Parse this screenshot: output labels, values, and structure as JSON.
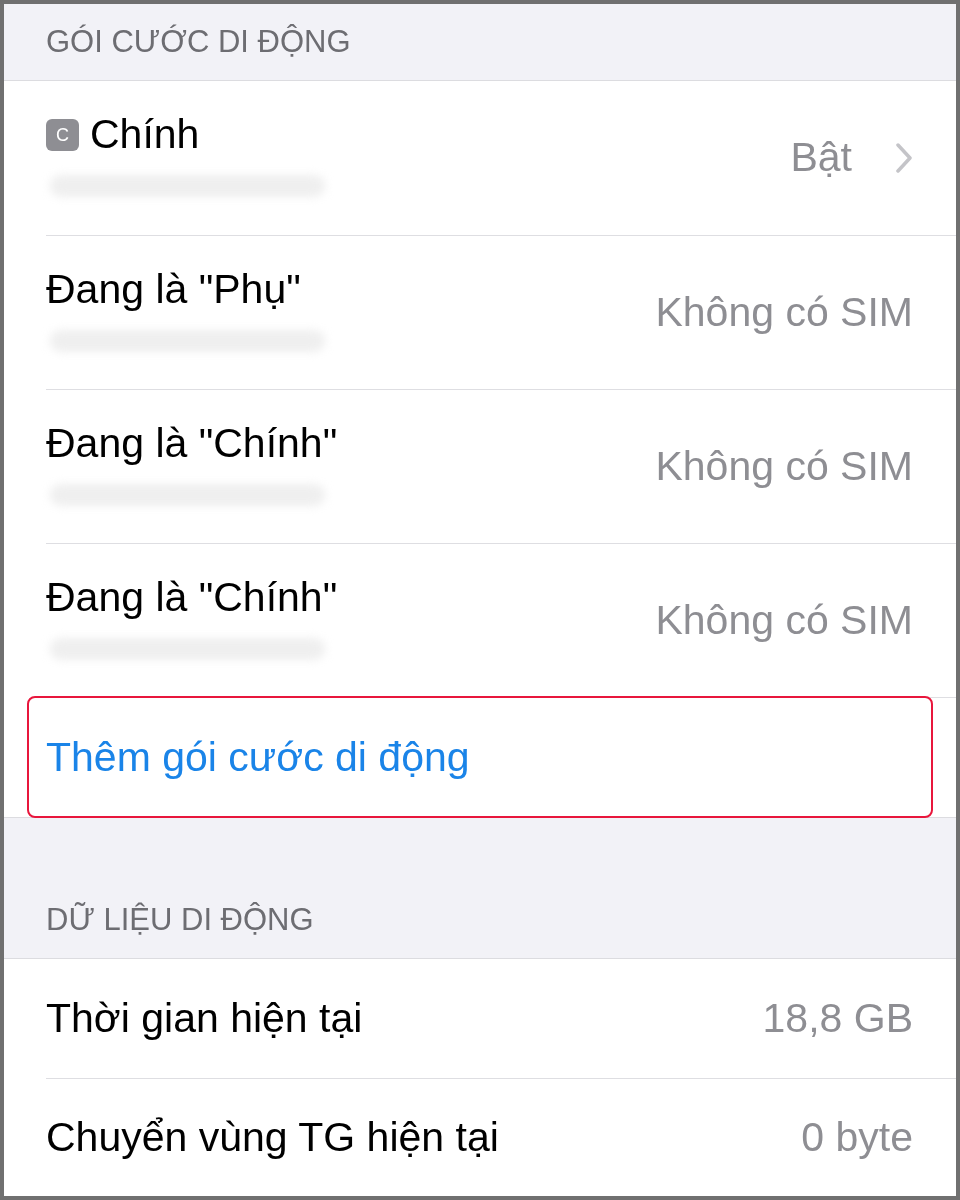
{
  "sections": [
    {
      "header": "GÓI CƯỚC DI ĐỘNG",
      "rows": [
        {
          "kind": "plan",
          "badge": "C",
          "title": "Chính",
          "value": "Bật",
          "chevron": true
        },
        {
          "kind": "plan",
          "title": "Đang là \"Phụ\"",
          "value": "Không có SIM",
          "chevron": false
        },
        {
          "kind": "plan",
          "title": "Đang là \"Chính\"",
          "value": "Không có SIM",
          "chevron": false
        },
        {
          "kind": "plan",
          "title": "Đang là \"Chính\"",
          "value": "Không có SIM",
          "chevron": false
        },
        {
          "kind": "action",
          "title": "Thêm gói cước di động",
          "highlighted": true
        }
      ]
    },
    {
      "header": "DỮ LIỆU DI ĐỘNG",
      "rows": [
        {
          "kind": "stat",
          "title": "Thời gian hiện tại",
          "value": "18,8 GB"
        },
        {
          "kind": "stat",
          "title": "Chuyển vùng TG hiện tại",
          "value": "0 byte"
        }
      ]
    }
  ]
}
